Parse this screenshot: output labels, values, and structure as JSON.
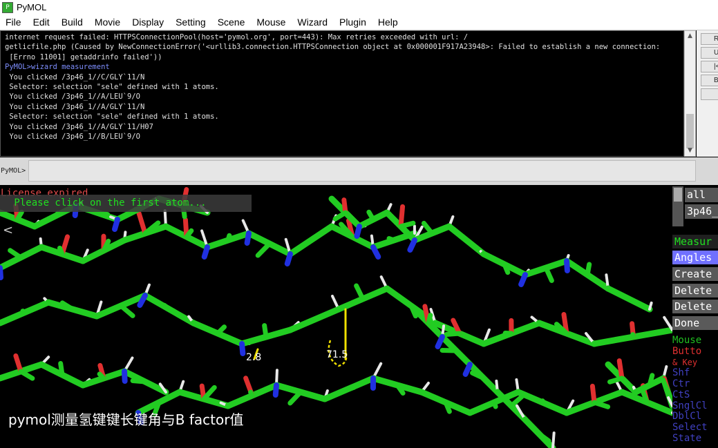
{
  "window": {
    "title": "PyMOL"
  },
  "menu": [
    "File",
    "Edit",
    "Build",
    "Movie",
    "Display",
    "Setting",
    "Scene",
    "Mouse",
    "Wizard",
    "Plugin",
    "Help"
  ],
  "console": {
    "lines": [
      "internet request failed: HTTPSConnectionPool(host='pymol.org', port=443): Max retries exceeded with url: /",
      "getlicfile.php (Caused by NewConnectionError('<urllib3.connection.HTTPSConnection object at 0x000001F917A23948>: Failed to establish a new connection:",
      " [Errno 11001] getaddrinfo failed'))",
      "PyMOL>wizard measurement",
      " You clicked /3p46_1//C/GLY`11/N",
      " Selector: selection \"sele\" defined with 1 atoms.",
      " You clicked /3p46_1//A/LEU`9/O",
      " You clicked /3p46_1//A/GLY`11/N",
      " Selector: selection \"sele\" defined with 1 atoms.",
      " You clicked /3p46_1//A/GLY`11/H07",
      " You clicked /3p46_1//B/LEU`9/O"
    ]
  },
  "right_panel": [
    "Re",
    "Un",
    "|<",
    "B",
    ""
  ],
  "command": {
    "prompt": "PyMOL>",
    "value": ""
  },
  "viewer": {
    "license": "License expired",
    "wizard_prompt": " Please click on the first atom...",
    "distance": "2.8",
    "angle": "71.5",
    "caption": "pymol测量氢键键长键角与B factor值",
    "back_glyph": "<"
  },
  "objects": [
    "all",
    "3p46_"
  ],
  "wizard_panel": {
    "title": "Measur",
    "buttons": [
      "Angles",
      "Create",
      "Delete",
      "Delete",
      "Done"
    ]
  },
  "mouse_panel": {
    "lines": [
      "Mouse",
      " Butto",
      "  & Key",
      "    Shf",
      "    Ctr",
      "    CtS",
      "SnglCl",
      " DblCl",
      "Select",
      "State"
    ]
  },
  "colors": {
    "carbon": "#22cc22",
    "oxygen": "#e03030",
    "nitrogen": "#2030e0",
    "hydrogen": "#e8e8e8",
    "measure": "#f0e000"
  }
}
